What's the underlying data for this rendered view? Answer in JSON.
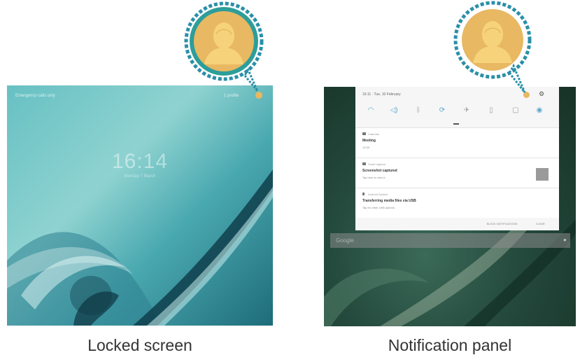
{
  "locked_screen": {
    "emergency_label": "Emergency calls only",
    "status_text": "1 profile",
    "time": "16:14",
    "date": "Monday 7 March"
  },
  "notification_panel": {
    "status_time": "16:11 · Tue, 10 February",
    "quick_settings_icons": [
      "wifi-icon",
      "sound-icon",
      "bluetooth-icon",
      "auto-rotate-icon",
      "airplane-mode-icon",
      "power-saving-icon",
      "screen-mirroring-icon",
      "location-icon"
    ],
    "notifications": [
      {
        "app": "Calendar",
        "title": "Meeting",
        "text": "14:33"
      },
      {
        "app": "Smart capture",
        "title": "Screenshot captured",
        "text": "Tap here to view it."
      },
      {
        "app": "Android System",
        "title": "Transferring media files via USB",
        "text": "Tap for other USB options."
      }
    ],
    "block_button": "BLOCK NOTIFICATIONS",
    "clear_button": "CLEAR",
    "search_placeholder": "Google"
  },
  "captions": {
    "left": "Locked screen",
    "right": "Notification panel"
  },
  "colors": {
    "callout_ring": "#2a8fa8",
    "callout_fill": "#e8b862",
    "avatar_silhouette": "#f6d37a"
  }
}
